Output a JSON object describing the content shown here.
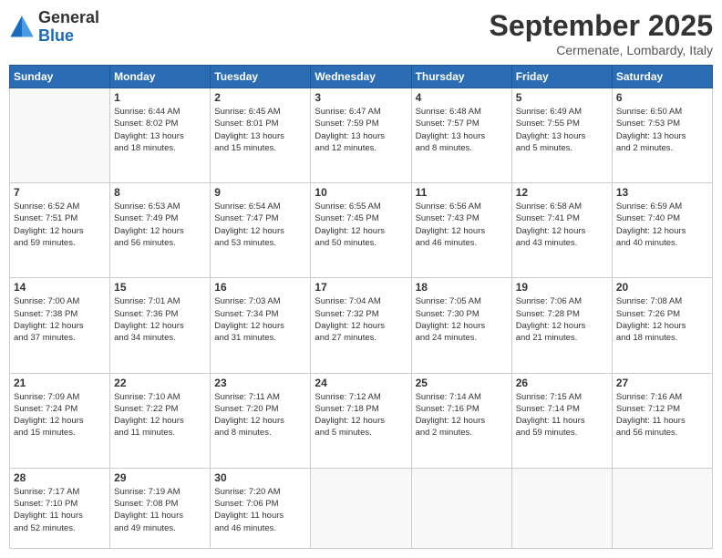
{
  "logo": {
    "general": "General",
    "blue": "Blue"
  },
  "header": {
    "month": "September 2025",
    "location": "Cermenate, Lombardy, Italy"
  },
  "days_of_week": [
    "Sunday",
    "Monday",
    "Tuesday",
    "Wednesday",
    "Thursday",
    "Friday",
    "Saturday"
  ],
  "weeks": [
    [
      {
        "day": "",
        "info": ""
      },
      {
        "day": "1",
        "info": "Sunrise: 6:44 AM\nSunset: 8:02 PM\nDaylight: 13 hours\nand 18 minutes."
      },
      {
        "day": "2",
        "info": "Sunrise: 6:45 AM\nSunset: 8:01 PM\nDaylight: 13 hours\nand 15 minutes."
      },
      {
        "day": "3",
        "info": "Sunrise: 6:47 AM\nSunset: 7:59 PM\nDaylight: 13 hours\nand 12 minutes."
      },
      {
        "day": "4",
        "info": "Sunrise: 6:48 AM\nSunset: 7:57 PM\nDaylight: 13 hours\nand 8 minutes."
      },
      {
        "day": "5",
        "info": "Sunrise: 6:49 AM\nSunset: 7:55 PM\nDaylight: 13 hours\nand 5 minutes."
      },
      {
        "day": "6",
        "info": "Sunrise: 6:50 AM\nSunset: 7:53 PM\nDaylight: 13 hours\nand 2 minutes."
      }
    ],
    [
      {
        "day": "7",
        "info": "Sunrise: 6:52 AM\nSunset: 7:51 PM\nDaylight: 12 hours\nand 59 minutes."
      },
      {
        "day": "8",
        "info": "Sunrise: 6:53 AM\nSunset: 7:49 PM\nDaylight: 12 hours\nand 56 minutes."
      },
      {
        "day": "9",
        "info": "Sunrise: 6:54 AM\nSunset: 7:47 PM\nDaylight: 12 hours\nand 53 minutes."
      },
      {
        "day": "10",
        "info": "Sunrise: 6:55 AM\nSunset: 7:45 PM\nDaylight: 12 hours\nand 50 minutes."
      },
      {
        "day": "11",
        "info": "Sunrise: 6:56 AM\nSunset: 7:43 PM\nDaylight: 12 hours\nand 46 minutes."
      },
      {
        "day": "12",
        "info": "Sunrise: 6:58 AM\nSunset: 7:41 PM\nDaylight: 12 hours\nand 43 minutes."
      },
      {
        "day": "13",
        "info": "Sunrise: 6:59 AM\nSunset: 7:40 PM\nDaylight: 12 hours\nand 40 minutes."
      }
    ],
    [
      {
        "day": "14",
        "info": "Sunrise: 7:00 AM\nSunset: 7:38 PM\nDaylight: 12 hours\nand 37 minutes."
      },
      {
        "day": "15",
        "info": "Sunrise: 7:01 AM\nSunset: 7:36 PM\nDaylight: 12 hours\nand 34 minutes."
      },
      {
        "day": "16",
        "info": "Sunrise: 7:03 AM\nSunset: 7:34 PM\nDaylight: 12 hours\nand 31 minutes."
      },
      {
        "day": "17",
        "info": "Sunrise: 7:04 AM\nSunset: 7:32 PM\nDaylight: 12 hours\nand 27 minutes."
      },
      {
        "day": "18",
        "info": "Sunrise: 7:05 AM\nSunset: 7:30 PM\nDaylight: 12 hours\nand 24 minutes."
      },
      {
        "day": "19",
        "info": "Sunrise: 7:06 AM\nSunset: 7:28 PM\nDaylight: 12 hours\nand 21 minutes."
      },
      {
        "day": "20",
        "info": "Sunrise: 7:08 AM\nSunset: 7:26 PM\nDaylight: 12 hours\nand 18 minutes."
      }
    ],
    [
      {
        "day": "21",
        "info": "Sunrise: 7:09 AM\nSunset: 7:24 PM\nDaylight: 12 hours\nand 15 minutes."
      },
      {
        "day": "22",
        "info": "Sunrise: 7:10 AM\nSunset: 7:22 PM\nDaylight: 12 hours\nand 11 minutes."
      },
      {
        "day": "23",
        "info": "Sunrise: 7:11 AM\nSunset: 7:20 PM\nDaylight: 12 hours\nand 8 minutes."
      },
      {
        "day": "24",
        "info": "Sunrise: 7:12 AM\nSunset: 7:18 PM\nDaylight: 12 hours\nand 5 minutes."
      },
      {
        "day": "25",
        "info": "Sunrise: 7:14 AM\nSunset: 7:16 PM\nDaylight: 12 hours\nand 2 minutes."
      },
      {
        "day": "26",
        "info": "Sunrise: 7:15 AM\nSunset: 7:14 PM\nDaylight: 11 hours\nand 59 minutes."
      },
      {
        "day": "27",
        "info": "Sunrise: 7:16 AM\nSunset: 7:12 PM\nDaylight: 11 hours\nand 56 minutes."
      }
    ],
    [
      {
        "day": "28",
        "info": "Sunrise: 7:17 AM\nSunset: 7:10 PM\nDaylight: 11 hours\nand 52 minutes."
      },
      {
        "day": "29",
        "info": "Sunrise: 7:19 AM\nSunset: 7:08 PM\nDaylight: 11 hours\nand 49 minutes."
      },
      {
        "day": "30",
        "info": "Sunrise: 7:20 AM\nSunset: 7:06 PM\nDaylight: 11 hours\nand 46 minutes."
      },
      {
        "day": "",
        "info": ""
      },
      {
        "day": "",
        "info": ""
      },
      {
        "day": "",
        "info": ""
      },
      {
        "day": "",
        "info": ""
      }
    ]
  ]
}
